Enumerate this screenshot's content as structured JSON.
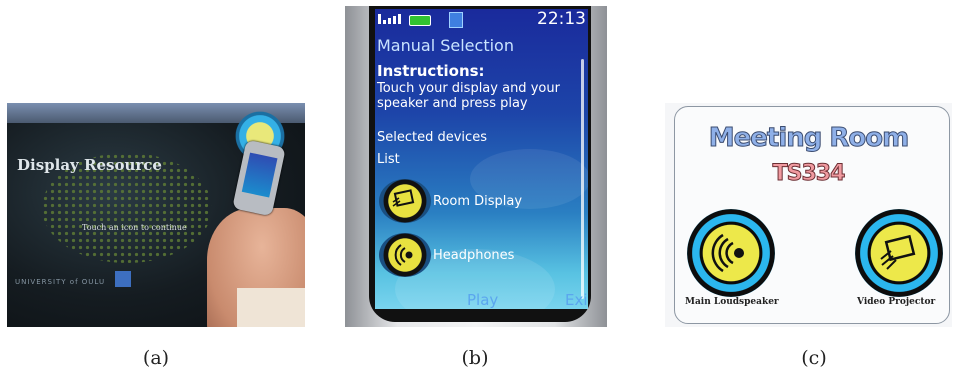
{
  "panel_a": {
    "screen_title": "Display Resource",
    "screen_hint": "Touch an icon to continue",
    "brand": "UNIVERSITY of OULU",
    "caption": "(a)"
  },
  "panel_b": {
    "clock": "22:13",
    "heading": "Manual Selection",
    "instructions_title": "Instructions:",
    "instructions_text": "Touch your display and your speaker and press play",
    "selected_devices": "Selected devices",
    "list_label": "List",
    "devices": [
      {
        "label": "Room Display",
        "icon": "display-icon"
      },
      {
        "label": "Headphones",
        "icon": "speaker-icon"
      }
    ],
    "softkey_left": "Play",
    "softkey_right": "Exit",
    "caption": "(b)"
  },
  "panel_c": {
    "room_title": "Meeting Room",
    "room_code": "TS334",
    "tags": [
      {
        "label": "Main Loudspeaker",
        "icon": "speaker-icon"
      },
      {
        "label": "Video Projector",
        "icon": "display-icon"
      }
    ],
    "caption": "(c)"
  }
}
